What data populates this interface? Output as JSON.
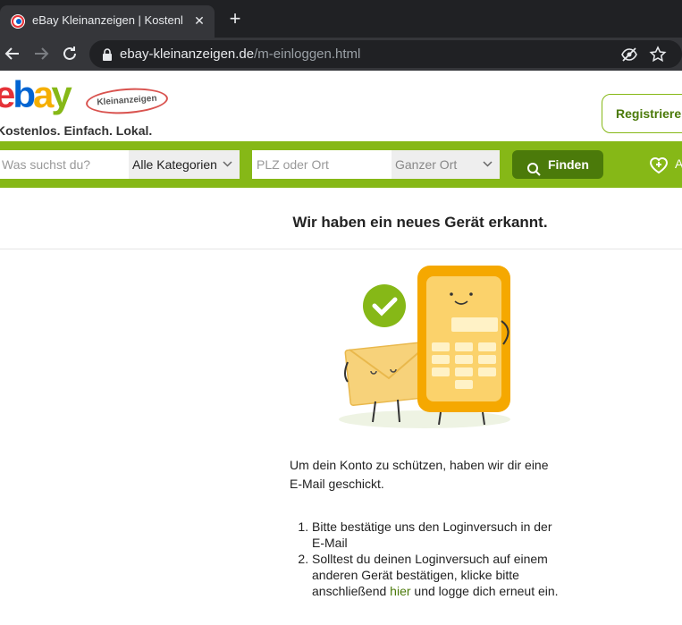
{
  "browser": {
    "tab_title": "eBay Kleinanzeigen | Kostenlo",
    "tab_close": "✕",
    "new_tab": "+",
    "url_host": "ebay-kleinanzeigen.de",
    "url_path": "/m-einloggen.html"
  },
  "header": {
    "logo_e": "e",
    "logo_b": "b",
    "logo_a": "a",
    "logo_y": "y",
    "logo_badge": "Kleinanzeigen",
    "tagline": "Kostenlos. Einfach. Lokal.",
    "register_label": "Registrieren"
  },
  "search": {
    "query_placeholder": "Was suchst du?",
    "category_value": "Alle Kategorien",
    "location_placeholder": "PLZ oder Ort",
    "radius_value": "Ganzer Ort",
    "find_label": "Finden",
    "heart_label": "A"
  },
  "main": {
    "headline": "Wir haben ein neues Gerät erkannt.",
    "body": "Um dein Konto zu schützen, haben wir dir eine E-Mail geschickt.",
    "step1": "Bitte bestätige uns den Loginversuch in der E-Mail",
    "step2_before": "Solltest du deinen Loginversuch auf einem anderen Gerät bestätigen, klicke bitte anschließend ",
    "step2_link": "hier",
    "step2_after": " und logge dich erneut ein."
  },
  "colors": {
    "brand_green": "#86b817",
    "dark_green": "#4b7a0a"
  }
}
